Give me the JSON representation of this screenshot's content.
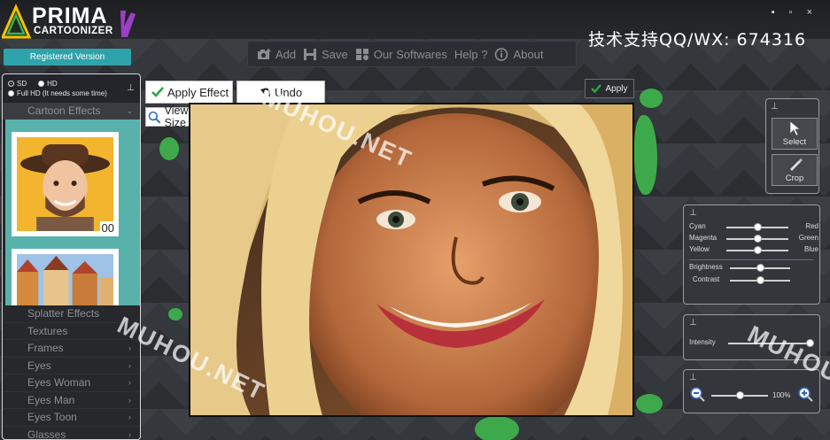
{
  "app": {
    "logo_title": "PRIMA",
    "logo_subtitle": "CARTOONIZER",
    "registration": "Registered Version",
    "window_controls": [
      "▪",
      "▫",
      "×"
    ],
    "overlay_text": "技术支持QQ/WX: 674316"
  },
  "toolbar": {
    "add": "Add",
    "save": "Save",
    "our_softwares": "Our Softwares",
    "help": "Help ?",
    "about": "About"
  },
  "resolution": {
    "sd": "SD",
    "hd": "HD",
    "full_hd": "Full HD (It needs some time)"
  },
  "sidebar": {
    "cartoon_effects": "Cartoon Effects",
    "thumb_number": "00",
    "menu": [
      "Splatter Effects",
      "Textures",
      "Frames",
      "Eyes",
      "Eyes Woman",
      "Eyes Man",
      "Eyes Toon",
      "Glasses"
    ]
  },
  "actions": {
    "apply_effect": "Apply Effect",
    "undo": "Undo",
    "view_full_size": "View Full Size",
    "apply": "Apply"
  },
  "tools": {
    "select": "Select",
    "crop": "Crop"
  },
  "color_balance": {
    "rows": [
      {
        "left": "Cyan",
        "right": "Red",
        "value": 0.5
      },
      {
        "left": "Magenta",
        "right": "Green",
        "value": 0.5
      },
      {
        "left": "Yellow",
        "right": "Blue",
        "value": 0.5
      }
    ],
    "brightness": "Brightness",
    "brightness_value": 0.5,
    "contrast": "Contrast",
    "contrast_value": 0.5
  },
  "intensity": {
    "label": "Intensity",
    "value": 1.0
  },
  "zoom": {
    "value_text": "100%",
    "value": 0.5
  },
  "watermarks": [
    "MUHOU.NET",
    "MUHOU.NET",
    "MUHOU.NET",
    "MUHOU"
  ],
  "colors": {
    "accent": "#2fa3ab",
    "effects_bg": "#58b2ab",
    "splatter": "#3ea94a"
  }
}
